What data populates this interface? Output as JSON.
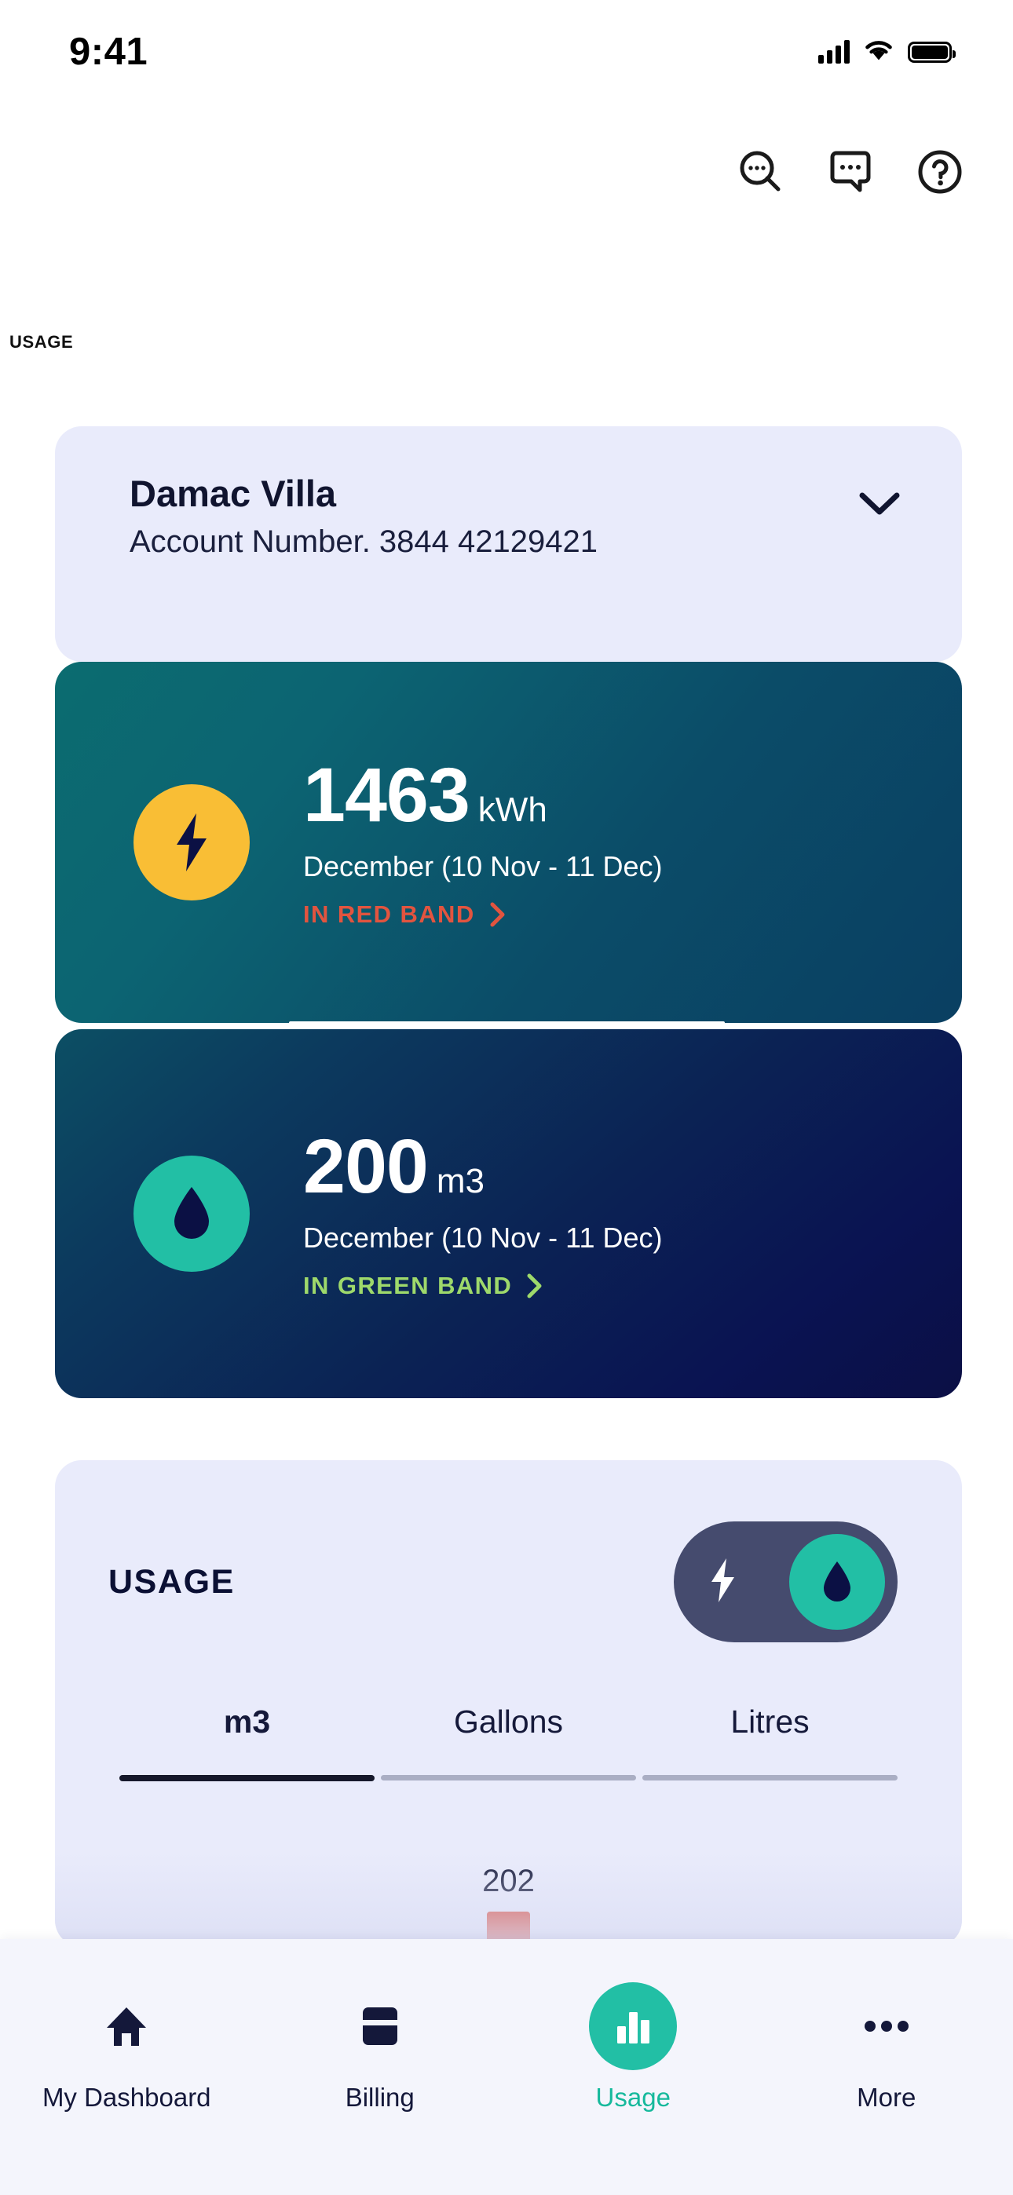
{
  "status_bar": {
    "time": "9:41",
    "cellular_icon": "cellular-signal-icon",
    "wifi_icon": "wifi-icon",
    "battery_icon": "battery-full-icon"
  },
  "header": {
    "search_icon": "search-dots-icon",
    "chat_icon": "chat-bubble-dots-icon",
    "help_icon": "help-circle-icon"
  },
  "breadcrumb": "USAGE",
  "account": {
    "name": "Damac Villa",
    "account_number_label": "Account Number. 3844 42129421",
    "expand_icon": "chevron-down-icon"
  },
  "utilities": [
    {
      "type": "electricity",
      "icon": "lightning-bolt-icon",
      "icon_bg": "#F9BE35",
      "value": "1463",
      "unit": "kWh",
      "period": "December (10 Nov - 11 Dec)",
      "band_label": "IN RED BAND",
      "band_color": "#E2543F",
      "band_arrow_icon": "chevron-right-icon"
    },
    {
      "type": "water",
      "icon": "water-droplet-icon",
      "icon_bg": "#22BFA5",
      "value": "200",
      "unit": "m3",
      "period": "December (10 Nov - 11 Dec)",
      "band_label": "IN GREEN BAND",
      "band_color": "#9ED96B",
      "band_arrow_icon": "chevron-right-icon"
    }
  ],
  "usage_panel": {
    "title": "USAGE",
    "toggle": {
      "left_icon": "lightning-bolt-icon",
      "right_icon": "water-droplet-icon",
      "selected": "water",
      "track_color": "#454B6E",
      "knob_color": "#22BFA5"
    },
    "unit_tabs": [
      {
        "label": "m3",
        "active": true
      },
      {
        "label": "Gallons",
        "active": false
      },
      {
        "label": "Litres",
        "active": false
      }
    ]
  },
  "chart_data": {
    "type": "bar",
    "title": "",
    "categories": [
      ""
    ],
    "values": [
      202
    ],
    "value_labels": [
      "202"
    ],
    "bar_color": "#D9402F",
    "xlabel": "",
    "ylabel": "",
    "note": "Chart is clipped by the viewport; only one labelled bar (202) is visible."
  },
  "bottom_nav": [
    {
      "label": "My Dashboard",
      "icon": "home-icon",
      "active": false
    },
    {
      "label": "Billing",
      "icon": "credit-card-icon",
      "active": false
    },
    {
      "label": "Usage",
      "icon": "bar-chart-icon",
      "active": true
    },
    {
      "label": "More",
      "icon": "ellipsis-icon",
      "active": false
    }
  ],
  "colors": {
    "panel_bg": "#E9EBFB",
    "accent_teal": "#22BFA5",
    "accent_yellow": "#F9BE35",
    "navy": "#0B1034",
    "nav_bg": "#F4F5FC"
  }
}
